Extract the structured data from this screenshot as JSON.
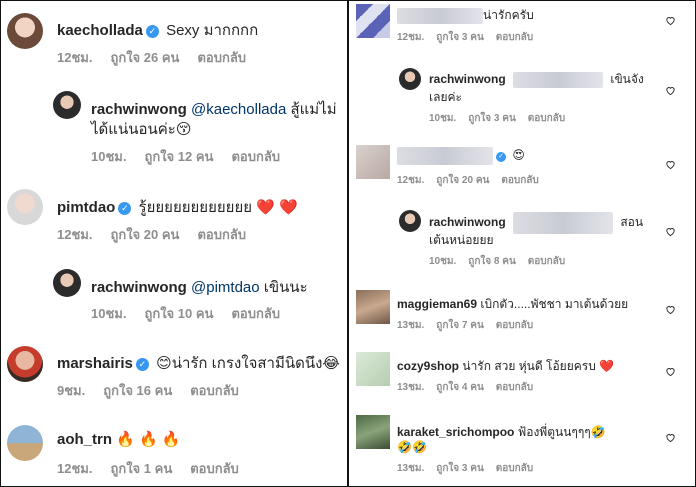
{
  "left": {
    "comments": [
      {
        "user": "kaechollada",
        "verified": true,
        "text": "Sexy มากกกก",
        "time": "12ชม.",
        "likes": "ถูกใจ 26 คน",
        "reply": "ตอบกลับ"
      },
      {
        "user": "rachwinwong",
        "mention": "@kaechollada",
        "text": "สู้แม่ไม่",
        "text2": "ได้แน่นอนค่ะ😚",
        "time": "10ชม.",
        "likes": "ถูกใจ 12 คน",
        "reply": "ตอบกลับ"
      },
      {
        "user": "pimtdao",
        "verified": true,
        "text": "รู้ยยยยยยยยยยยย ❤️ ❤️",
        "time": "12ชม.",
        "likes": "ถูกใจ 20 คน",
        "reply": "ตอบกลับ"
      },
      {
        "user": "rachwinwong",
        "mention": "@pimtdao",
        "text": "เขินนะ",
        "time": "10ชม.",
        "likes": "ถูกใจ 10 คน",
        "reply": "ตอบกลับ"
      },
      {
        "user": "marshairis",
        "verified": true,
        "text": "😊น่ารัก เกรงใจสามีนิดนึง😂",
        "time": "9ชม.",
        "likes": "ถูกใจ 16 คน",
        "reply": "ตอบกลับ"
      },
      {
        "user": "aoh_trn",
        "text": "🔥 🔥 🔥",
        "time": "12ชม.",
        "likes": "ถูกใจ 1 คน",
        "reply": "ตอบกลับ"
      }
    ]
  },
  "right": {
    "comments": [
      {
        "user": "",
        "text": "น่ารักครับ",
        "time": "12ชม.",
        "likes": "ถูกใจ 3 คน",
        "reply": "ตอบกลับ"
      },
      {
        "user": "rachwinwong",
        "text": "เขินจัง",
        "text2": "เลยค่ะ",
        "time": "10ชม.",
        "likes": "ถูกใจ 3 คน",
        "reply": "ตอบกลับ"
      },
      {
        "user": "",
        "text": "😍",
        "time": "12ชม.",
        "likes": "ถูกใจ 20 คน",
        "reply": "ตอบกลับ"
      },
      {
        "user": "rachwinwong",
        "text": "สอน",
        "text2": "เต้นหน่อยยย",
        "time": "10ชม.",
        "likes": "ถูกใจ 8 คน",
        "reply": "ตอบกลับ"
      },
      {
        "user": "maggieman69",
        "text": "เบิกตัว.....พัชชา มาเต้นด้วยย",
        "time": "13ชม.",
        "likes": "ถูกใจ 7 คน",
        "reply": "ตอบกลับ"
      },
      {
        "user": "cozy9shop",
        "text": "น่ารัก สวย หุ่นดี โอ้ยยครบ ❤️",
        "time": "13ชม.",
        "likes": "ถูกใจ 4 คน",
        "reply": "ตอบกลับ"
      },
      {
        "user": "karaket_srichompoo",
        "text": "ฟ้องพี่ตูนนๆๆๆ🤣",
        "text2": "🤣🤣",
        "time": "13ชม.",
        "likes": "ถูกใจ 3 คน",
        "reply": "ตอบกลับ"
      }
    ]
  },
  "colors": {
    "accent_blue": "#3897f0",
    "meta_gray": "#8e8e8e",
    "mention": "#003569"
  }
}
